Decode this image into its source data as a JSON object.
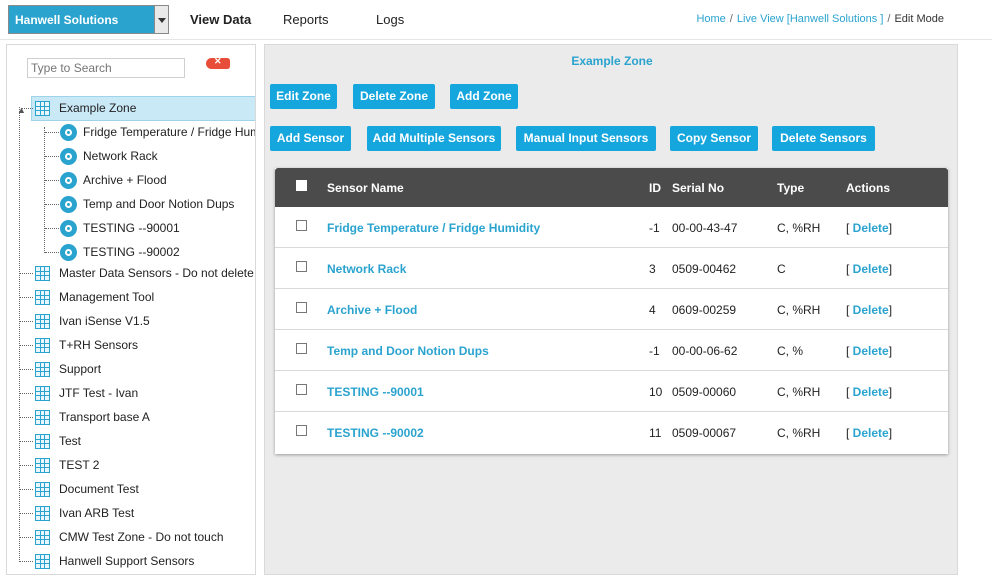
{
  "header": {
    "org_select": "Hanwell Solutions",
    "nav": [
      "View Data",
      "Reports",
      "Logs"
    ],
    "breadcrumb": {
      "home": "Home",
      "live": "Live View [Hanwell Solutions ]",
      "current": "Edit Mode"
    }
  },
  "sidebar": {
    "search_placeholder": "Type to Search",
    "selected_zone": "Example Zone",
    "child_sensors": [
      "Fridge Temperature / Fridge Humidity",
      "Network Rack",
      "Archive + Flood",
      "Temp and Door Notion Dups",
      "TESTING --90001",
      "TESTING --90002"
    ],
    "zones": [
      "Master Data Sensors - Do not delete",
      "Management Tool",
      "Ivan iSense V1.5",
      "T+RH Sensors",
      "Support",
      "JTF Test - Ivan",
      "Transport base A",
      "Test",
      "TEST 2",
      "Document Test",
      "Ivan ARB Test",
      "CMW Test Zone - Do not touch",
      "Hanwell Support Sensors"
    ]
  },
  "main": {
    "zone_title": "Example Zone",
    "zone_buttons": [
      "Edit Zone",
      "Delete Zone",
      "Add Zone"
    ],
    "sensor_buttons": [
      "Add Sensor",
      "Add Multiple Sensors",
      "Manual Input Sensors",
      "Copy Sensor",
      "Delete Sensors"
    ],
    "table": {
      "headers": {
        "name": "Sensor Name",
        "id": "ID",
        "serial": "Serial No",
        "type": "Type",
        "actions": "Actions"
      },
      "delete_label": "Delete",
      "rows": [
        {
          "name": "Fridge Temperature / Fridge Humidity",
          "id": "-1",
          "serial": "00-00-43-47",
          "type": "C, %RH"
        },
        {
          "name": "Network Rack",
          "id": "3",
          "serial": "0509-00462",
          "type": "C"
        },
        {
          "name": "Archive + Flood",
          "id": "4",
          "serial": "0609-00259",
          "type": "C, %RH"
        },
        {
          "name": "Temp and Door Notion Dups",
          "id": "-1",
          "serial": "00-00-06-62",
          "type": "C, %"
        },
        {
          "name": "TESTING --90001",
          "id": "10",
          "serial": "0509-00060",
          "type": "C, %RH"
        },
        {
          "name": "TESTING --90002",
          "id": "11",
          "serial": "0509-00067",
          "type": "C, %RH"
        }
      ]
    }
  },
  "colors": {
    "accent": "#2aa3cf",
    "button": "#16a6de",
    "table_header": "#4b4b4b",
    "clear_icon": "#e84d3a"
  }
}
